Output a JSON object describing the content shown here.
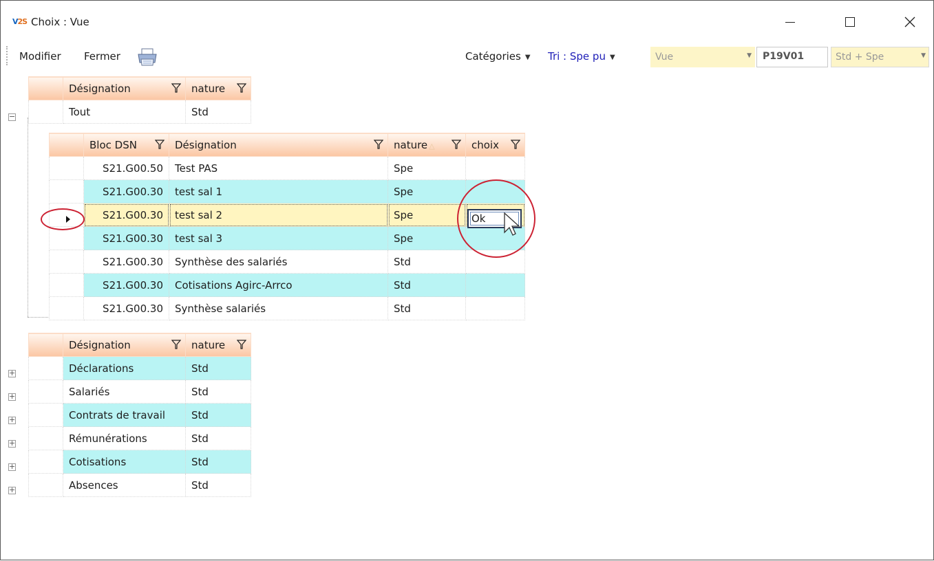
{
  "window": {
    "logo_left": "V",
    "logo_right": "2S",
    "title": "Choix : Vue"
  },
  "toolbar": {
    "modifier": "Modifier",
    "fermer": "Fermer",
    "categories": "Catégories",
    "tri": "Tri : Spe pu",
    "vue_placeholder": "Vue",
    "code": "P19V01",
    "std_spe": "Std + Spe"
  },
  "grid_top": {
    "headers": [
      "Désignation",
      "nature"
    ],
    "rows": [
      {
        "designation": "Tout",
        "nature": "Std"
      }
    ]
  },
  "grid_detail": {
    "headers": [
      "Bloc DSN",
      "Désignation",
      "nature",
      "choix"
    ],
    "rows": [
      {
        "bloc": "S21.G00.50",
        "designation": "Test PAS",
        "nature": "Spe",
        "choix": ""
      },
      {
        "bloc": "S21.G00.30",
        "designation": "test sal 1",
        "nature": "Spe",
        "choix": ""
      },
      {
        "bloc": "S21.G00.30",
        "designation": "test sal 2",
        "nature": "Spe",
        "choix": "Ok"
      },
      {
        "bloc": "S21.G00.30",
        "designation": "test sal 3",
        "nature": "Spe",
        "choix": ""
      },
      {
        "bloc": "S21.G00.30",
        "designation": "Synthèse des salariés",
        "nature": "Std",
        "choix": ""
      },
      {
        "bloc": "S21.G00.30",
        "designation": "Cotisations Agirc-Arrco",
        "nature": "Std",
        "choix": ""
      },
      {
        "bloc": "S21.G00.30",
        "designation": "Synthèse salariés",
        "nature": "Std",
        "choix": ""
      }
    ]
  },
  "grid_bottom": {
    "headers": [
      "Désignation",
      "nature"
    ],
    "rows": [
      {
        "designation": "Déclarations",
        "nature": "Std"
      },
      {
        "designation": "Salariés",
        "nature": "Std"
      },
      {
        "designation": "Contrats de travail",
        "nature": "Std"
      },
      {
        "designation": "Rémunérations",
        "nature": "Std"
      },
      {
        "designation": "Cotisations",
        "nature": "Std"
      },
      {
        "designation": "Absences",
        "nature": "Std"
      }
    ]
  },
  "colors": {
    "header_gradient_end": "#fbc6a3",
    "row_cyan": "#b9f4f4",
    "row_selected": "#fff5c0",
    "annotation_red": "#cc2233",
    "tri_text": "#2020b8"
  }
}
